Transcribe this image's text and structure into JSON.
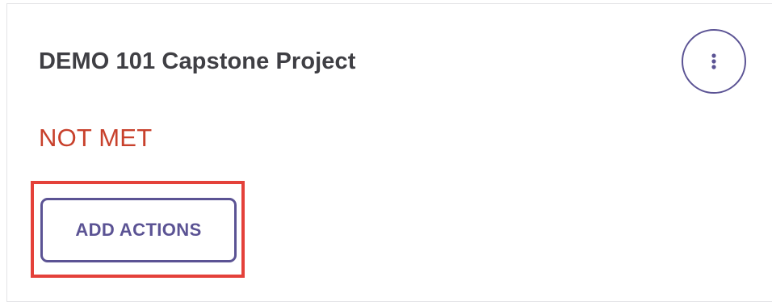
{
  "card": {
    "title": "DEMO 101 Capstone Project",
    "status": "NOT MET",
    "more_menu_icon": "kebab-vertical-icon",
    "add_actions_label": "ADD ACTIONS"
  },
  "colors": {
    "title_text": "#3f3f44",
    "status_not_met": "#c8412c",
    "accent": "#5b5394",
    "highlight_box": "#e4413a",
    "card_border": "#e3e3e6"
  }
}
